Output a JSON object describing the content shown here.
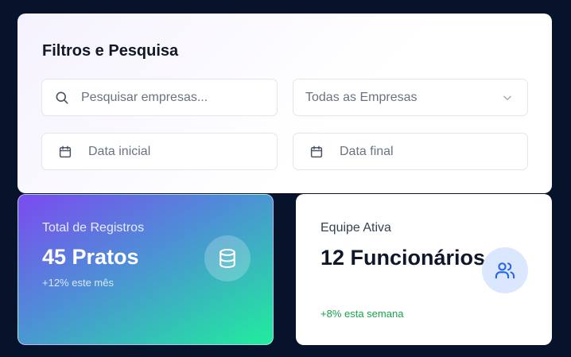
{
  "filters": {
    "title": "Filtros e Pesquisa",
    "search_placeholder": "Pesquisar empresas...",
    "company_select": "Todas as Empresas",
    "start_date_placeholder": "Data inicial",
    "end_date_placeholder": "Data final"
  },
  "stats": {
    "records": {
      "label": "Total de Registros",
      "value": "45 Pratos",
      "change": "+12% este mês",
      "icon": "database-icon"
    },
    "team": {
      "label": "Equipe Ativa",
      "value": "12 Funcionários",
      "change": "+8% esta semana",
      "icon": "users-icon"
    }
  },
  "colors": {
    "background": "#07122b",
    "gradient_start": "#7c4af0",
    "gradient_end": "#20ee9c",
    "positive": "#16a34a",
    "icon_accent": "#2563eb"
  }
}
